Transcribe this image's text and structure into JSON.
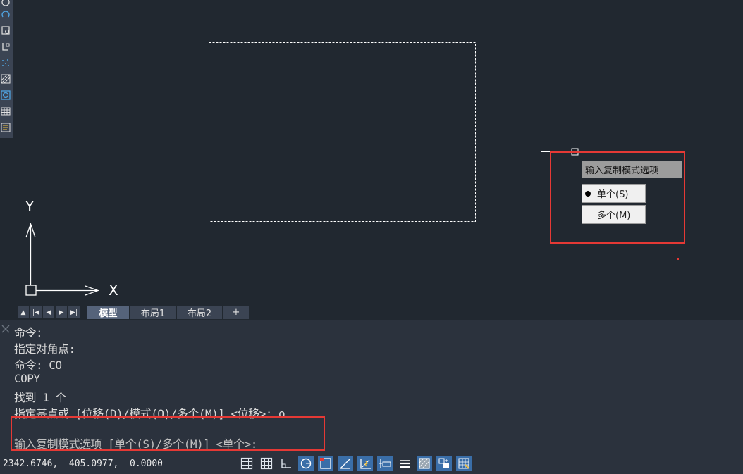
{
  "tabs": {
    "model": "模型",
    "layout1": "布局1",
    "layout2": "布局2",
    "add": "+"
  },
  "ucs": {
    "x_label": "X",
    "y_label": "Y"
  },
  "prompt": {
    "title": "输入复制模式选项",
    "single": "单个(S)",
    "multiple": "多个(M)",
    "selected": "single"
  },
  "command_history": [
    "命令:",
    "指定对角点:",
    "命令: CO",
    "COPY",
    "找到 1 个",
    "指定基点或 [位移(D)/模式(O)/多个(M)] <位移>: o"
  ],
  "command_input": "输入复制模式选项 [单个(S)/多个(M)] <单个>:",
  "coordinates": "2342.6746,  405.0977,  0.0000",
  "colors": {
    "canvas": "#212830",
    "panel": "#2b323d",
    "toolbar": "#3b4453",
    "highlight": "#e53935",
    "active_tool": "#3a6ea8"
  },
  "status_icons": [
    "grid-icon",
    "snap-icon",
    "ortho-icon",
    "polar-icon",
    "object-snap-icon",
    "object-track-icon",
    "dynamic-ucs-icon",
    "dynamic-input-icon",
    "lineweight-icon",
    "transparency-icon",
    "selection-cycling-icon",
    "annotation-icon"
  ]
}
